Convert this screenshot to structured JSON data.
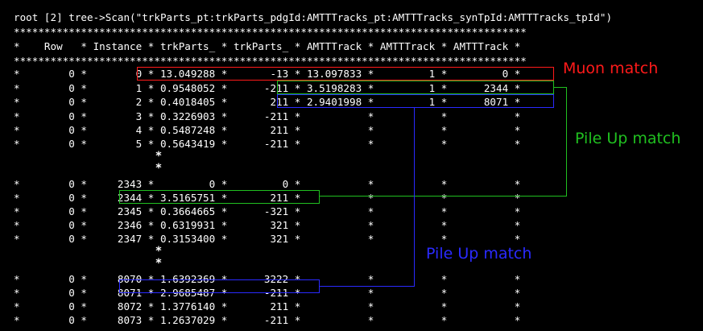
{
  "terminal": {
    "command": "root [2] tree->Scan(\"trkParts_pt:trkParts_pdgId:AMTTTracks_pt:AMTTTracks_synTpId:AMTTTracks_tpId\")",
    "separator": "************************************************************************************",
    "header": "*    Row   * Instance * trkParts_ * trkParts_ * AMTTTrack * AMTTTrack * AMTTTrack *",
    "rows_block1": [
      "*        0 *        0 * 13.049288 *       -13 * 13.097833 *         1 *         0 *",
      "*        0 *        1 * 0.9548052 *      -211 * 3.5198283 *         1 *      2344 *",
      "*        0 *        2 * 0.4018405 *       211 * 2.9401998 *         1 *      8071 *",
      "*        0 *        3 * 0.3226903 *      -211 *           *           *           *",
      "*        0 *        4 * 0.5487248 *       211 *           *           *           *",
      "*        0 *        5 * 0.5643419 *      -211 *           *           *           *"
    ],
    "rows_block2": [
      "*        0 *     2343 *         0 *         0 *           *           *           *",
      "*        0 *     2344 * 3.5165751 *       211 *           *           *           *",
      "*        0 *     2345 * 0.3664665 *      -321 *           *           *           *",
      "*        0 *     2346 * 0.6319931 *       321 *           *           *           *",
      "*        0 *     2347 * 0.3153400 *       321 *           *           *           *"
    ],
    "rows_block3": [
      "*        0 *     8070 * 1.6392369 *      3222 *           *           *           *",
      "*        0 *     8071 * 2.9685487 *      -211 *           *           *           *",
      "*        0 *     8072 * 1.3776140 *       211 *           *           *           *",
      "*        0 *     8073 * 1.2637029 *      -211 *           *           *           *"
    ],
    "ellipsis_mark": "*"
  },
  "annotations": {
    "muon": "Muon match",
    "pileup_green": "Pile Up match",
    "pileup_blue": "Pile Up match"
  },
  "colors": {
    "background": "#000000",
    "text": "#ffffff",
    "muon": "#ff1a1a",
    "green": "#20c020",
    "blue": "#2a2aff"
  }
}
